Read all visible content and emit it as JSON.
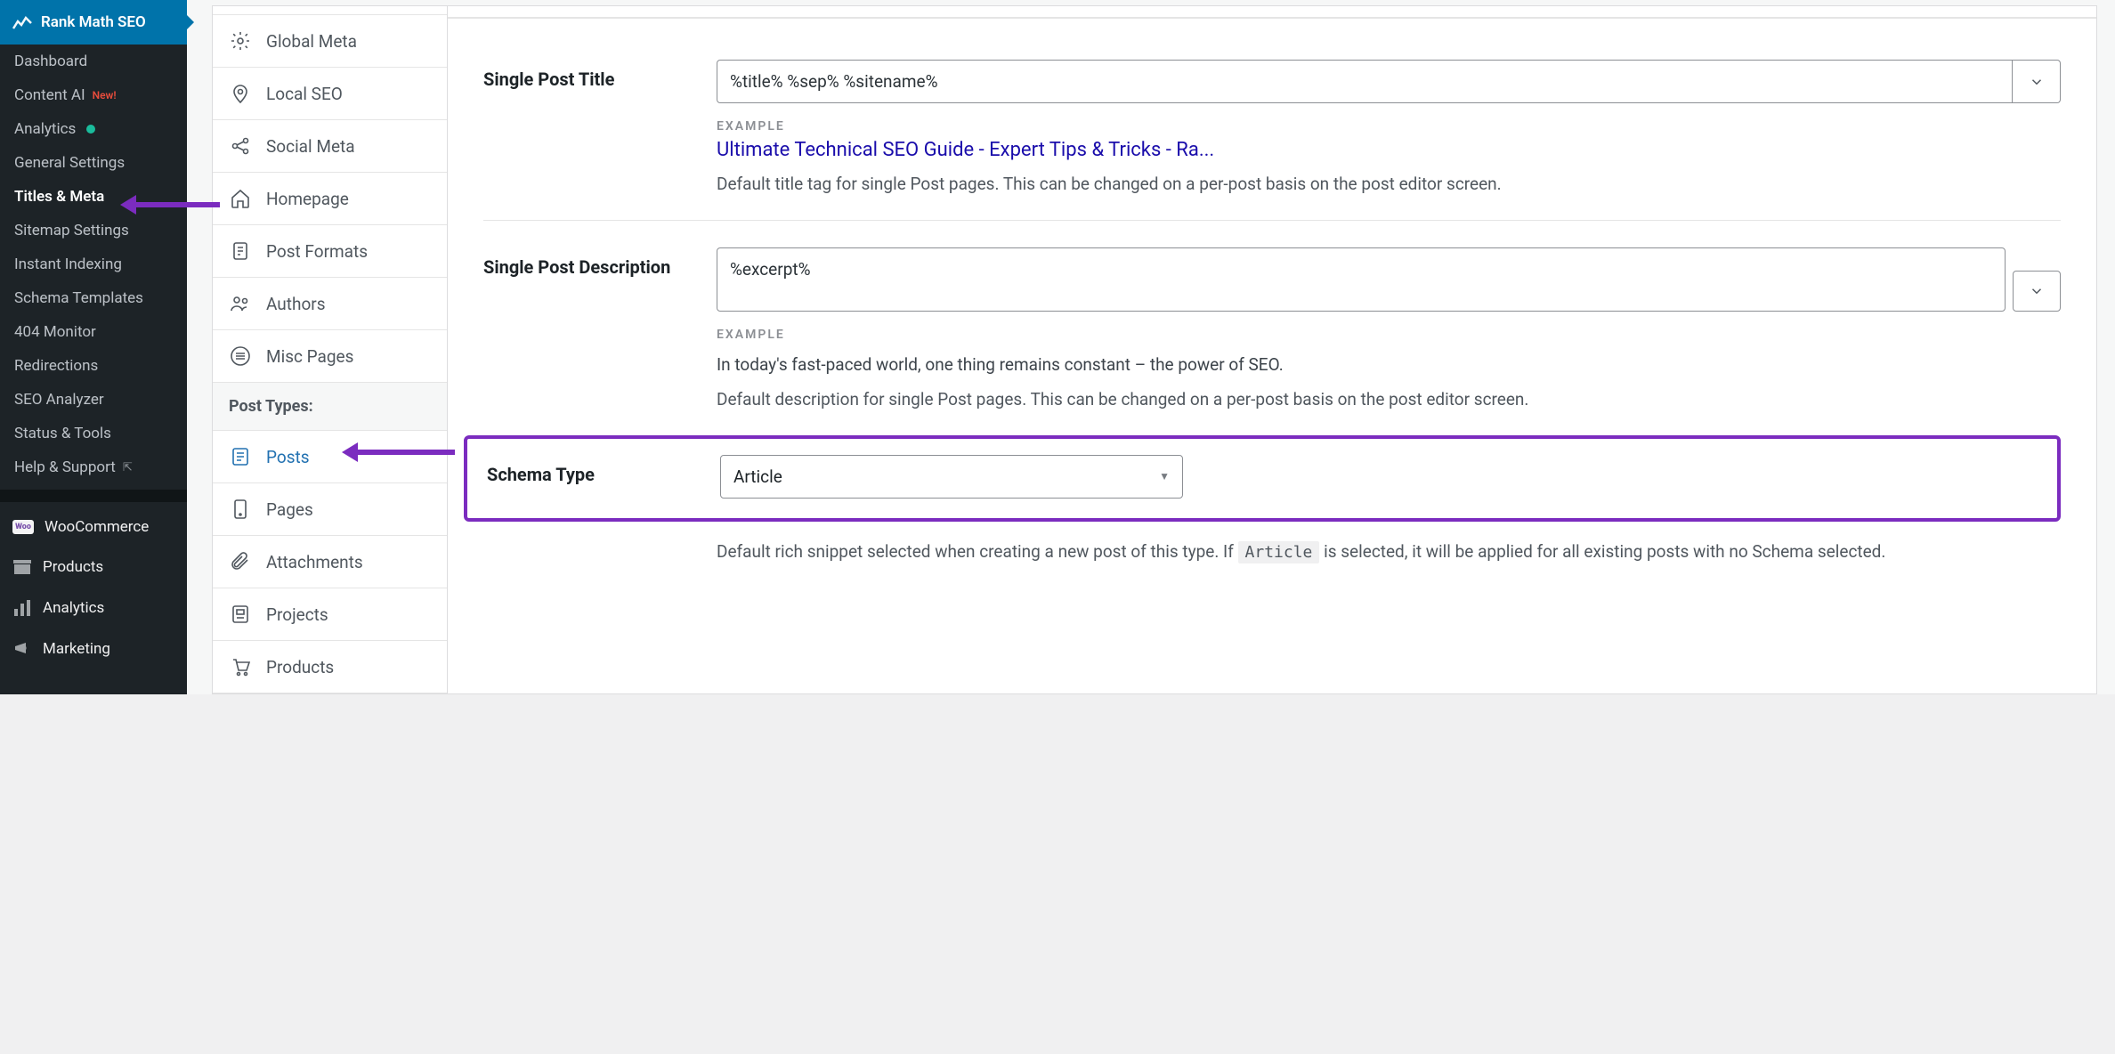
{
  "wp_sidebar": {
    "active_head": "Rank Math SEO",
    "subitems": [
      {
        "label": "Dashboard"
      },
      {
        "label": "Content AI",
        "badge": "New!"
      },
      {
        "label": "Analytics",
        "dot": true
      },
      {
        "label": "General Settings"
      },
      {
        "label": "Titles & Meta",
        "current": true
      },
      {
        "label": "Sitemap Settings"
      },
      {
        "label": "Instant Indexing"
      },
      {
        "label": "Schema Templates"
      },
      {
        "label": "404 Monitor"
      },
      {
        "label": "Redirections"
      },
      {
        "label": "SEO Analyzer"
      },
      {
        "label": "Status & Tools"
      },
      {
        "label": "Help & Support",
        "ext": true
      }
    ],
    "main_items": [
      {
        "label": "WooCommerce",
        "icon": "woo"
      },
      {
        "label": "Products",
        "icon": "archive"
      },
      {
        "label": "Analytics",
        "icon": "bars"
      },
      {
        "label": "Marketing",
        "icon": "megaphone"
      }
    ]
  },
  "tabs": {
    "general": [
      {
        "label": "Global Meta",
        "icon": "gear"
      },
      {
        "label": "Local SEO",
        "icon": "pin"
      },
      {
        "label": "Social Meta",
        "icon": "share"
      },
      {
        "label": "Homepage",
        "icon": "home"
      },
      {
        "label": "Post Formats",
        "icon": "doc-gear"
      },
      {
        "label": "Authors",
        "icon": "users"
      },
      {
        "label": "Misc Pages",
        "icon": "list"
      }
    ],
    "post_types_header": "Post Types:",
    "post_types": [
      {
        "label": "Posts",
        "icon": "post",
        "active": true
      },
      {
        "label": "Pages",
        "icon": "page"
      },
      {
        "label": "Attachments",
        "icon": "clip"
      },
      {
        "label": "Projects",
        "icon": "project"
      },
      {
        "label": "Products",
        "icon": "cart"
      }
    ]
  },
  "form": {
    "title_label": "Single Post Title",
    "title_value": "%title% %sep% %sitename%",
    "example_label": "EXAMPLE",
    "title_example": "Ultimate Technical SEO Guide - Expert Tips & Tricks - Ra...",
    "title_help": "Default title tag for single Post pages. This can be changed on a per-post basis on the post editor screen.",
    "desc_label": "Single Post Description",
    "desc_value": "%excerpt%",
    "desc_example": "In today's fast-paced world, one thing remains constant – the power of SEO.",
    "desc_help": "Default description for single Post pages. This can be changed on a per-post basis on the post editor screen.",
    "schema_label": "Schema Type",
    "schema_value": "Article",
    "schema_help_pre": "Default rich snippet selected when creating a new post of this type. If ",
    "schema_help_code": "Article",
    "schema_help_post": " is selected, it will be applied for all existing posts with no Schema selected."
  }
}
